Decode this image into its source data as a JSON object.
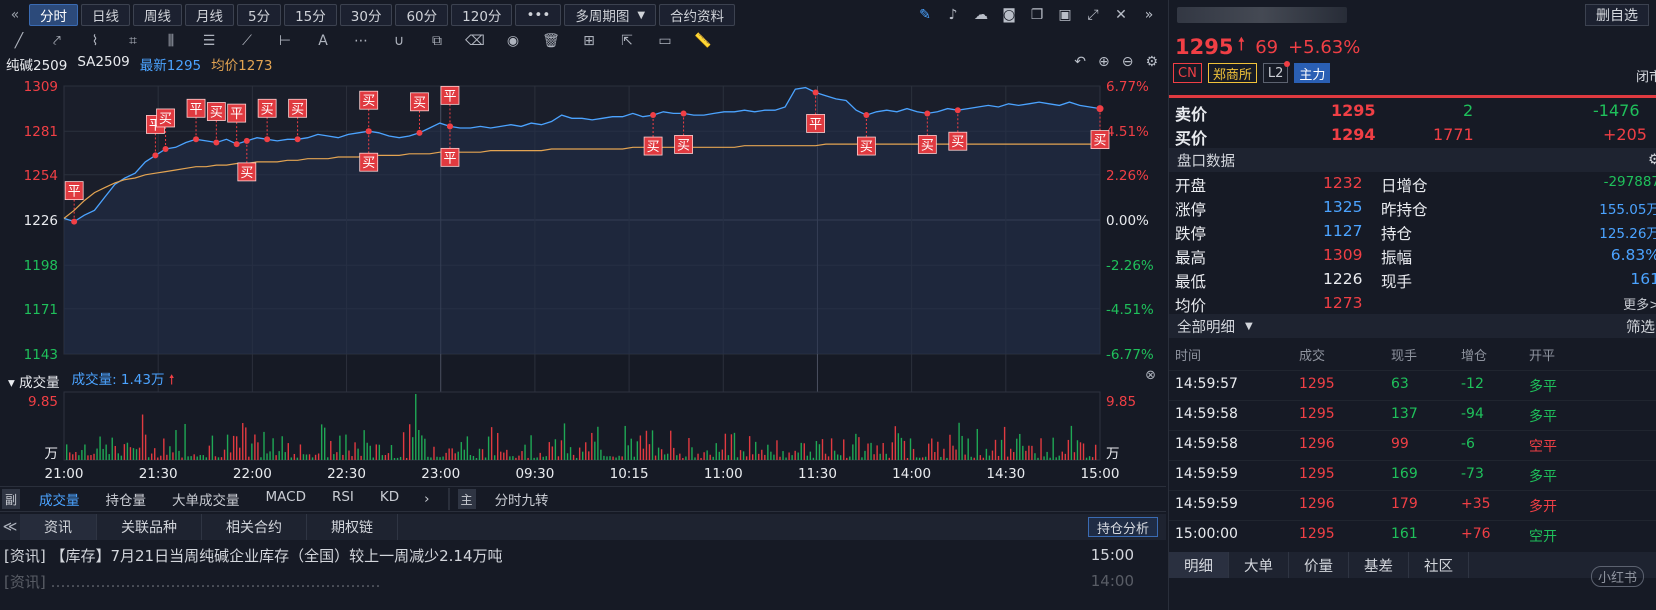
{
  "toolbar": {
    "periods": [
      "分时",
      "日线",
      "周线",
      "月线",
      "5分",
      "15分",
      "30分",
      "60分",
      "120分"
    ],
    "active_period": "分时",
    "more": "•••",
    "multi": "多周期图",
    "contract_info": "合约资料"
  },
  "drawing_tools": [
    "pencil-line-icon",
    "ray-icon",
    "polyline-icon",
    "crop-icon",
    "parallel-icon",
    "fib-icon",
    "fan-icon",
    "range-icon",
    "text-icon",
    "more-icon",
    "magnet-icon",
    "copy-icon",
    "eraser-icon",
    "eye-icon",
    "trash-icon",
    "grid-icon",
    "export-icon",
    "comment-icon",
    "ruler-icon"
  ],
  "header": {
    "name": "纯碱2509",
    "code": "SA2509",
    "latest": "最新1295",
    "avg": "均价1273"
  },
  "chart_data": {
    "type": "line",
    "title": "",
    "x_labels": [
      "21:00",
      "21:30",
      "22:00",
      "22:30",
      "23:00",
      "09:30",
      "10:15",
      "11:00",
      "11:30",
      "14:00",
      "14:30",
      "15:00"
    ],
    "y_labels_left": [
      1309,
      1281,
      1254,
      1226,
      1198,
      1171,
      1143
    ],
    "y_labels_right": [
      "6.77%",
      "4.51%",
      "2.26%",
      "0.00%",
      "-2.26%",
      "-4.51%",
      "-6.77%"
    ],
    "ylim": [
      1143,
      1309
    ],
    "prev_close": 1226,
    "series": [
      {
        "name": "最新",
        "color": "#4ba3ff",
        "values": [
          1227,
          1225,
          1229,
          1232,
          1240,
          1248,
          1252,
          1255,
          1262,
          1266,
          1270,
          1271,
          1274,
          1276,
          1275,
          1274,
          1276,
          1273,
          1275,
          1277,
          1276,
          1275,
          1276,
          1276,
          1277,
          1279,
          1278,
          1277,
          1279,
          1280,
          1281,
          1280,
          1278,
          1277,
          1278,
          1280,
          1283,
          1286,
          1284,
          1283,
          1283,
          1284,
          1283,
          1284,
          1285,
          1284,
          1286,
          1285,
          1287,
          1291,
          1289,
          1289,
          1288,
          1289,
          1290,
          1290,
          1292,
          1290,
          1291,
          1293,
          1292,
          1292,
          1291,
          1291,
          1292,
          1293,
          1293,
          1294,
          1293,
          1294,
          1294,
          1296,
          1307,
          1308,
          1305,
          1303,
          1301,
          1300,
          1294,
          1291,
          1293,
          1294,
          1293,
          1295,
          1293,
          1292,
          1293,
          1295,
          1294,
          1295,
          1296,
          1297,
          1296,
          1298,
          1297,
          1298,
          1299,
          1298,
          1297,
          1299,
          1297,
          1296,
          1295
        ]
      },
      {
        "name": "均价",
        "color": "#e3a452",
        "values": [
          1227,
          1232,
          1238,
          1243,
          1246,
          1249,
          1251,
          1252,
          1254,
          1255,
          1256,
          1257,
          1258,
          1259,
          1259,
          1260,
          1260,
          1261,
          1261,
          1262,
          1262,
          1262,
          1263,
          1263,
          1264,
          1264,
          1264,
          1265,
          1265,
          1265,
          1266,
          1266,
          1266,
          1266,
          1267,
          1267,
          1267,
          1268,
          1268,
          1268,
          1268,
          1268,
          1269,
          1269,
          1269,
          1269,
          1269,
          1269,
          1270,
          1270,
          1270,
          1270,
          1270,
          1270,
          1270,
          1270,
          1271,
          1271,
          1271,
          1271,
          1271,
          1271,
          1271,
          1271,
          1271,
          1271,
          1271,
          1272,
          1272,
          1272,
          1272,
          1272,
          1272,
          1272,
          1272,
          1273,
          1273,
          1273,
          1273,
          1273,
          1273,
          1273,
          1273,
          1273,
          1273,
          1273,
          1273,
          1273,
          1273,
          1273,
          1273,
          1273,
          1273,
          1273,
          1273,
          1273,
          1273,
          1273,
          1273,
          1273,
          1273,
          1273,
          1273
        ]
      }
    ],
    "markers": [
      {
        "i": 1,
        "label": "平",
        "pos": "up"
      },
      {
        "i": 9,
        "label": "平",
        "pos": "up"
      },
      {
        "i": 10,
        "label": "买",
        "pos": "up"
      },
      {
        "i": 13,
        "label": "平",
        "pos": "up"
      },
      {
        "i": 15,
        "label": "买",
        "pos": "up"
      },
      {
        "i": 17,
        "label": "平",
        "pos": "up"
      },
      {
        "i": 18,
        "label": "买",
        "pos": "down"
      },
      {
        "i": 20,
        "label": "买",
        "pos": "up"
      },
      {
        "i": 23,
        "label": "买",
        "pos": "up"
      },
      {
        "i": 30,
        "label": "买",
        "pos": "up"
      },
      {
        "i": 30,
        "label": "买",
        "pos": "down"
      },
      {
        "i": 35,
        "label": "买",
        "pos": "up"
      },
      {
        "i": 38,
        "label": "平",
        "pos": "up"
      },
      {
        "i": 38,
        "label": "平",
        "pos": "down"
      },
      {
        "i": 58,
        "label": "买",
        "pos": "down"
      },
      {
        "i": 61,
        "label": "买",
        "pos": "down"
      },
      {
        "i": 74,
        "label": "平",
        "pos": "down"
      },
      {
        "i": 79,
        "label": "买",
        "pos": "down"
      },
      {
        "i": 85,
        "label": "买",
        "pos": "down"
      },
      {
        "i": 88,
        "label": "买",
        "pos": "down"
      },
      {
        "i": 102,
        "label": "买",
        "pos": "down"
      }
    ]
  },
  "volume": {
    "title": "成交量",
    "label": "成交量: 1.43万",
    "max_label": "9.85",
    "unit": "万"
  },
  "indicators": {
    "tag": "副",
    "items": [
      "成交量",
      "持仓量",
      "大单成交量",
      "MACD",
      "RSI",
      "KD"
    ],
    "active": "成交量",
    "main_tag": "主",
    "main_item": "分时九转"
  },
  "news": {
    "tabs": [
      "资讯",
      "关联品种",
      "相关合约",
      "期权链"
    ],
    "active": "资讯",
    "hold_btn": "持仓分析",
    "rows": [
      {
        "text": "[资讯]   【库存】7月21日当周纯碱企业库存（全国）较上一周减少2.14万吨",
        "time": "15:00"
      },
      {
        "text": "[资讯]   …………………………………………………………",
        "time": "14:00"
      }
    ]
  },
  "quote": {
    "watch_btn": "删自选",
    "price": "1295",
    "change": "69",
    "pct": "+5.63%",
    "tags": [
      "CN",
      "郑商所",
      "L2",
      "主力"
    ],
    "closed": "闭市",
    "sell": {
      "label": "卖价",
      "price": "1295",
      "qty": "2",
      "chg": "-1476"
    },
    "buy": {
      "label": "买价",
      "price": "1294",
      "qty": "1771",
      "chg": "+205"
    },
    "section": "盘口数据",
    "left": [
      {
        "k": "开盘",
        "v": "1232",
        "c": "red"
      },
      {
        "k": "涨停",
        "v": "1325",
        "c": "blue"
      },
      {
        "k": "跌停",
        "v": "1127",
        "c": "blue"
      },
      {
        "k": "最高",
        "v": "1309",
        "c": "red"
      },
      {
        "k": "最低",
        "v": "1226",
        "c": "white"
      },
      {
        "k": "均价",
        "v": "1273",
        "c": "red"
      }
    ],
    "right": [
      {
        "k": "日增仓",
        "v": "-297887",
        "c": "green"
      },
      {
        "k": "昨持仓",
        "v": "155.05万",
        "c": "blue"
      },
      {
        "k": "持仓",
        "v": "125.26万",
        "c": "blue"
      },
      {
        "k": "振幅",
        "v": "6.83%",
        "c": "blue"
      },
      {
        "k": "现手",
        "v": "161",
        "c": "blue"
      }
    ],
    "more": "更多>",
    "detail_title": "全部明细",
    "filter": "筛选",
    "detail_cols": [
      "时间",
      "成交",
      "现手",
      "增仓",
      "开平"
    ],
    "detail": [
      {
        "t": "14:59:57",
        "p": "1295",
        "q": "63",
        "qc": "green",
        "d": "-12",
        "dc": "green",
        "o": "多平",
        "oc": "green"
      },
      {
        "t": "14:59:58",
        "p": "1295",
        "q": "137",
        "qc": "green",
        "d": "-94",
        "dc": "green",
        "o": "多平",
        "oc": "green"
      },
      {
        "t": "14:59:58",
        "p": "1296",
        "q": "99",
        "qc": "red",
        "d": "-6",
        "dc": "green",
        "o": "空平",
        "oc": "red"
      },
      {
        "t": "14:59:59",
        "p": "1295",
        "q": "169",
        "qc": "green",
        "d": "-73",
        "dc": "green",
        "o": "多平",
        "oc": "green"
      },
      {
        "t": "14:59:59",
        "p": "1296",
        "q": "179",
        "qc": "red",
        "d": "+35",
        "dc": "red",
        "o": "多开",
        "oc": "red"
      },
      {
        "t": "15:00:00",
        "p": "1295",
        "q": "161",
        "qc": "green",
        "d": "+76",
        "dc": "red",
        "o": "空开",
        "oc": "green"
      }
    ],
    "bottom_tabs": [
      "明细",
      "大单",
      "价量",
      "基差",
      "社区"
    ],
    "active_tab": "明细",
    "watermark": "小红书"
  }
}
